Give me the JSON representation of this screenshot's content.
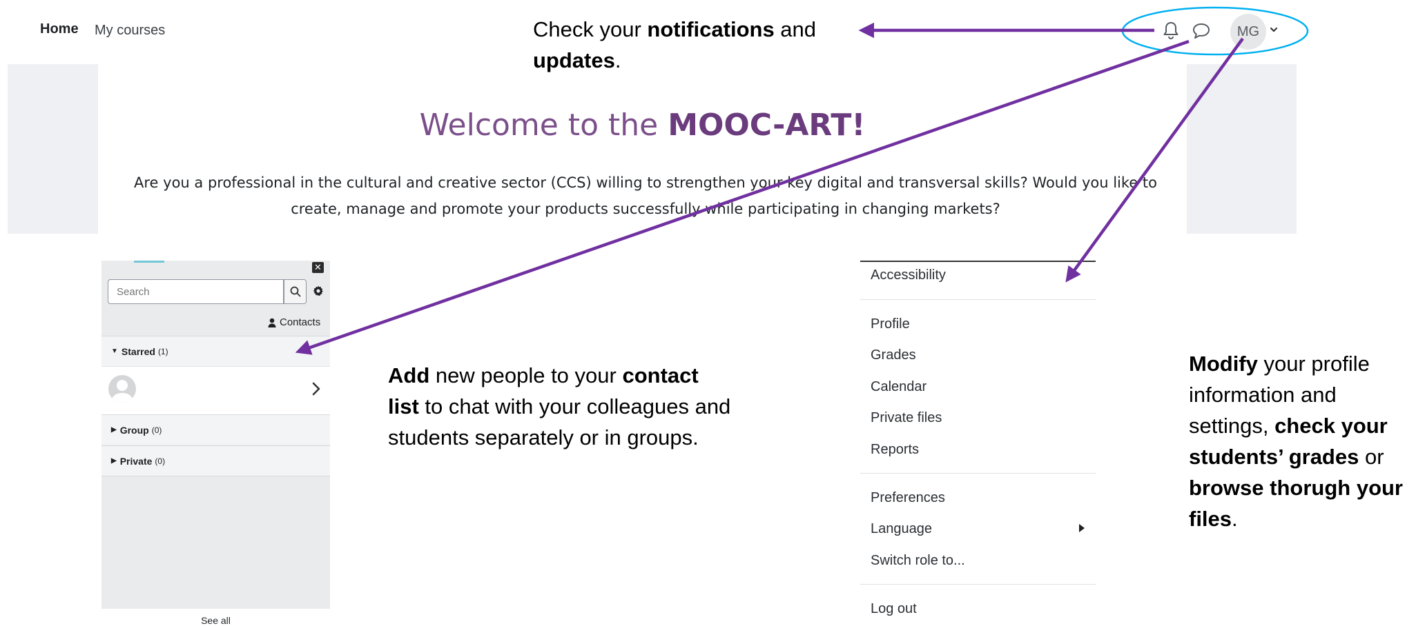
{
  "nav": {
    "home": "Home",
    "my_courses": "My courses",
    "avatar_initials": "MG"
  },
  "banner": {
    "welcome_prefix": "Welcome to the ",
    "welcome_brand": "MOOC-ART!",
    "intro": "Are you a professional in the cultural and creative sector (CCS) willing to strengthen your key digital and transversal skills? Would you like to create, manage and promote your products successfully while participating in changing markets?"
  },
  "annotations": {
    "notif": {
      "t1": "Check your ",
      "b1": "notifications",
      "t2": " and ",
      "b2": "updates",
      "t3": "."
    },
    "contacts": {
      "b1": "Add",
      "t1": " new people to your ",
      "b2": "contact list",
      "t2": " to chat with your colleagues and students separately or in groups."
    },
    "profile": {
      "b1": "Modify",
      "t1": " your profile information and settings, ",
      "b2": "check your students’ grades",
      "t2": " or ",
      "b3": "browse thorugh your files",
      "t3": "."
    }
  },
  "drawer": {
    "search_placeholder": "Search",
    "contacts_label": "Contacts",
    "sections": [
      {
        "label": "Starred",
        "count": "(1)"
      },
      {
        "label": "Group",
        "count": "(0)"
      },
      {
        "label": "Private",
        "count": "(0)"
      }
    ],
    "see_all": "See all"
  },
  "menu": {
    "items": [
      "Accessibility",
      "Profile",
      "Grades",
      "Calendar",
      "Private files",
      "Reports",
      "Preferences",
      "Language",
      "Switch role to...",
      "Log out"
    ]
  },
  "colors": {
    "arrow": "#7030a0",
    "highlight_ellipse": "#00b0f0",
    "brand": "#6a3b7d"
  },
  "icons": [
    "bell-icon",
    "chat-icon",
    "chevron-down-icon",
    "close-icon",
    "search-icon",
    "gear-icon",
    "user-icon",
    "chevron-right-icon"
  ]
}
